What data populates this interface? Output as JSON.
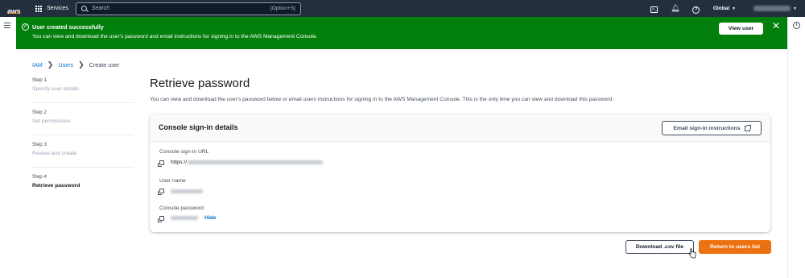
{
  "topnav": {
    "logo_text": "aws",
    "services_label": "Services",
    "search_placeholder": "Search",
    "search_shortcut": "[Option+S]",
    "region_label": "Global",
    "icons": [
      "cloudshell-icon",
      "bell-icon",
      "help-icon"
    ]
  },
  "flash": {
    "title": "User created successfully",
    "message": "You can view and download the user's password and email instructions for signing in to the AWS Management Console.",
    "view_user_label": "View user",
    "close_glyph": "✕",
    "color": "#037f0c"
  },
  "breadcrumb": {
    "items": [
      "IAM",
      "Users",
      "Create user"
    ],
    "separator": "❯"
  },
  "steps": [
    {
      "num": "Step 1",
      "label": "Specify user details",
      "active": false
    },
    {
      "num": "Step 2",
      "label": "Set permissions",
      "active": false
    },
    {
      "num": "Step 3",
      "label": "Review and create",
      "active": false
    },
    {
      "num": "Step 4",
      "label": "Retrieve password",
      "active": true
    }
  ],
  "main": {
    "title": "Retrieve password",
    "description": "You can view and download the user's password below or email users instructions for signing in to the AWS Management Console. This is the only time you can view and download this password."
  },
  "card": {
    "title": "Console sign-in details",
    "email_button_label": "Email sign-in instructions",
    "url_label": "Console sign-in URL",
    "url_prefix": "https://",
    "username_label": "User name",
    "password_label": "Console password",
    "hide_label": "Hide"
  },
  "actions": {
    "download_label": "Download .csv file",
    "return_label": "Return to users list",
    "primary_color": "#ec7211"
  }
}
